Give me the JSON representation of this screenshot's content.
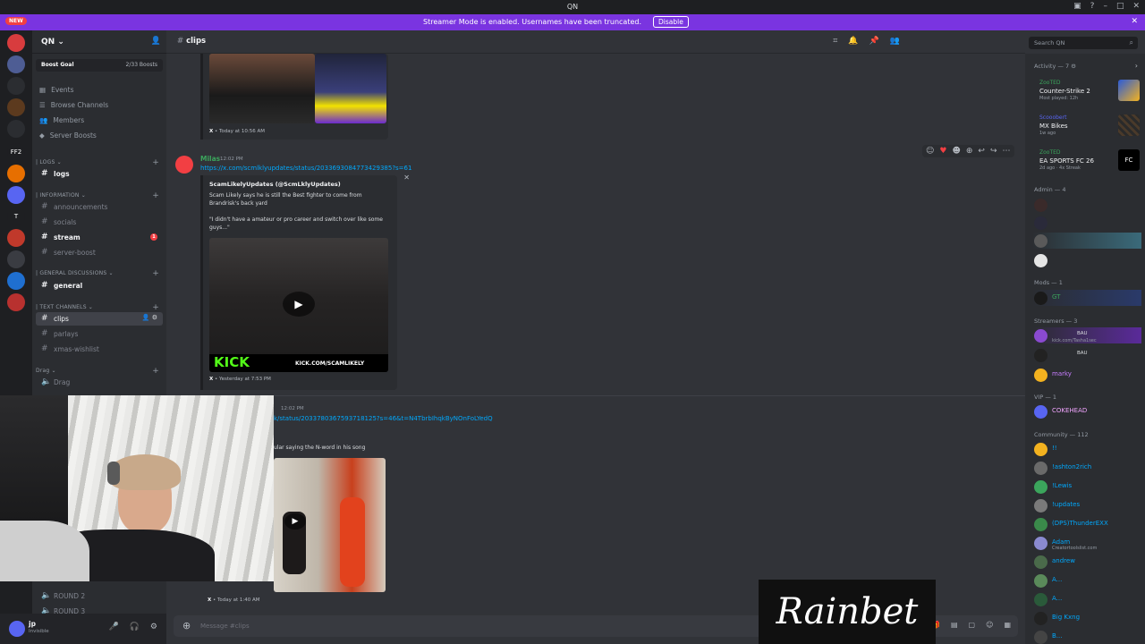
{
  "window": {
    "title": "QN",
    "new_badge": "NEW"
  },
  "banner": {
    "text": "Streamer Mode is enabled. Usernames have been truncated.",
    "button": "Disable"
  },
  "servers": [
    {
      "label": "",
      "badge": "",
      "color": "#d83c3e"
    },
    {
      "label": "",
      "badge": "",
      "color": "#4e5d94"
    },
    {
      "label": "",
      "badge": "",
      "color": "#2b2d31"
    },
    {
      "label": "",
      "badge": "",
      "color": "#5c3a1e"
    },
    {
      "label": "",
      "badge": "",
      "color": "#2b2d31"
    },
    {
      "label": "FF2",
      "badge": "",
      "color": "#1e1f22"
    },
    {
      "label": "",
      "badge": "",
      "color": "#e76f00"
    },
    {
      "label": "",
      "badge": "",
      "color": "#5865f2"
    },
    {
      "label": "T",
      "badge": "",
      "color": "#1e1f22"
    },
    {
      "label": "",
      "badge": "",
      "color": "#c0392b"
    },
    {
      "label": "",
      "badge": "",
      "color": "#3a3c42"
    },
    {
      "label": "",
      "badge": "",
      "color": "#1f6fd0"
    },
    {
      "label": "",
      "badge": "",
      "color": "#b8312f"
    }
  ],
  "guild": {
    "name": "QN",
    "boost_goal": "Boost Goal",
    "boost_count": "2/33 Boosts",
    "nav": [
      "Events",
      "Browse Channels",
      "Members",
      "Server Boosts"
    ],
    "categories": {
      "logs": "LOGS",
      "information": "INFORMATION",
      "general": "GENERAL DISCUSSIONS",
      "text": "TEXT CHANNELS",
      "drag": "Drag"
    },
    "channels": {
      "logs": "logs",
      "announcements": "announcements",
      "socials": "socials",
      "stream": "stream",
      "stream_badge": "1",
      "server_boost": "server-boost",
      "general": "general",
      "clips": "clips",
      "parlays": "parlays",
      "xmas": "xmas-wishlist",
      "drag": "Drag",
      "round2": "ROUND 2",
      "round3": "ROUND 3"
    }
  },
  "user": {
    "name": "jp",
    "status": "Invisible"
  },
  "channel_header": {
    "name": "clips",
    "search_placeholder": "Search QN"
  },
  "messages": {
    "prev_footer_source": "X",
    "prev_footer_time": "Today at 10:56 AM",
    "m1": {
      "author": "Milas",
      "time": "12:02 PM",
      "link": "https://x.com/scmlklyupdates/status/2033693084773429385?s=61",
      "embed_author": "ScamLikelyUpdates (@ScmLklyUpdates)",
      "embed_line1": "Scam Likely says he is still the Best fighter to come from Brandrisk's back yard",
      "embed_line2": "\"I didn't have a amateur or pro career and switch over like some guys...\"",
      "kick_text": "KICK",
      "kick_url": "KICK.COM/SCAMLIKELY",
      "footer_source": "X",
      "footer_time": "Yesterday at 7:53 PM"
    },
    "m2": {
      "time": "12:02 PM",
      "link": "k/status/2033780367593718125?s=46&t=N4TbrbIhqkByNOnFoLYedQ",
      "line1": "ular saying the N-word in his song",
      "footer_source": "X",
      "footer_time": "Today at 1:40 AM"
    }
  },
  "composer": {
    "placeholder": "Message #clips"
  },
  "members": {
    "activity_header": "Activity — 7",
    "activities": [
      {
        "name": "ZooTED",
        "game": "Counter-Strike 2",
        "sub": "Most played: 12h",
        "color": "#e7a31e"
      },
      {
        "name": "Scooobert",
        "game": "MX Bikes",
        "sub": "1w ago",
        "color": "#3a3a3a"
      },
      {
        "name": "ZooTED",
        "game": "EA SPORTS FC 26",
        "sub": "2d ago · 4x Streak",
        "color": "#111111"
      }
    ],
    "admin_header": "Admin — 4",
    "mods_header": "Mods — 1",
    "mod_name": "GT",
    "streamers_header": "Streamers — 3",
    "streamer1_sub": "kick.com/Tasha1sec",
    "streamer_tag": "BAU",
    "streamer3": "marky",
    "vip_header": "VIP — 1",
    "vip_name": "COKEHEAD",
    "community_header": "Community — 112",
    "community": [
      {
        "name": "!!",
        "sub": ""
      },
      {
        "name": "!ashton2rich",
        "sub": ""
      },
      {
        "name": "!Lewis",
        "sub": ""
      },
      {
        "name": "!updates",
        "sub": ""
      },
      {
        "name": "(DPS)ThunderEXX",
        "sub": ""
      },
      {
        "name": "Adam",
        "sub": "Creatortoolslist.com"
      },
      {
        "name": "andrew",
        "sub": ""
      },
      {
        "name": "A...",
        "sub": ""
      },
      {
        "name": "A...",
        "sub": ""
      },
      {
        "name": "Big Kxng",
        "sub": ""
      },
      {
        "name": "B...",
        "sub": ""
      }
    ]
  },
  "overlay": {
    "brand": "Rainbet"
  }
}
